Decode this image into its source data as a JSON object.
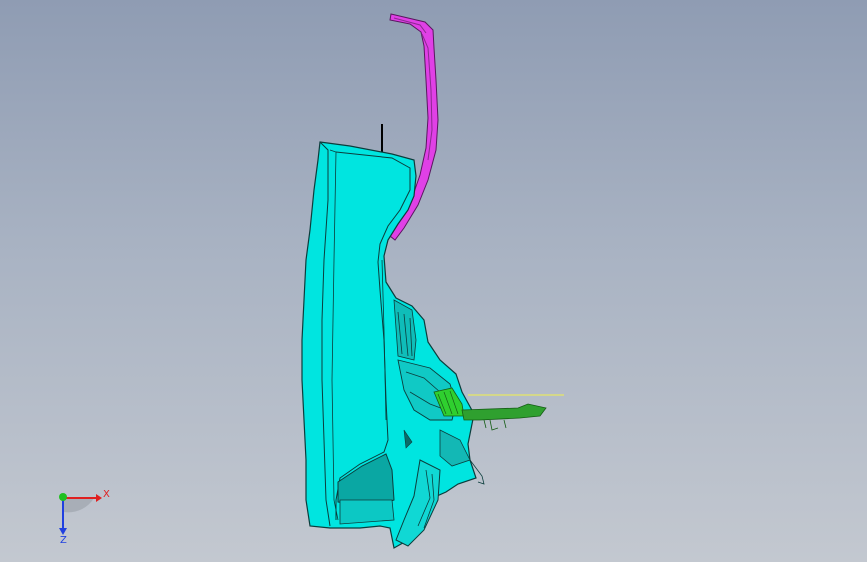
{
  "viewport": {
    "background_top": "#8f9cb3",
    "background_bottom": "#c3c8d0"
  },
  "model": {
    "main_part_color": "#00e5e0",
    "main_part_edge_color": "#0b3d3c",
    "upper_bracket_color": "#e040e6",
    "small_part_color": "#2fcf2f",
    "reference_line_color": "#f2f24a"
  },
  "triad": {
    "x_label": "X",
    "z_label": "Z",
    "x_color": "#e02020",
    "y_color": "#20c020",
    "z_color": "#2040e0"
  }
}
